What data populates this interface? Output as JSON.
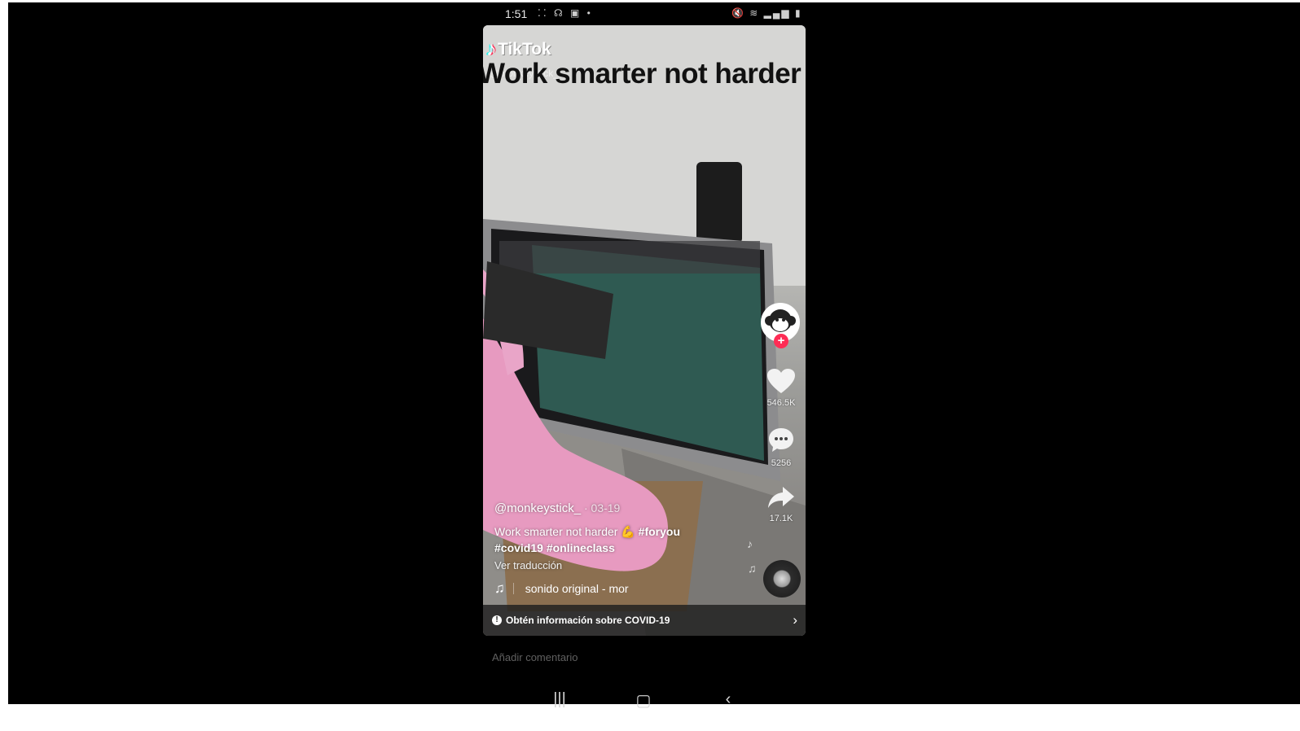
{
  "status_bar": {
    "time": "1:51",
    "left_icons": "⁚⁚ ☊ ▣ •",
    "right_icons": "🔇 ≋ ▂▄▆ ▮"
  },
  "video": {
    "brand": "TikTok",
    "brand_icon": "tiktok-note-icon",
    "watermark_handle": "@monkeystick_",
    "overlay_text": "Work smarter not harder"
  },
  "actions": {
    "likes": "546.5K",
    "comments": "5256",
    "shares": "17.1K"
  },
  "caption": {
    "author": "@monkeystick_",
    "date": " · 03-19",
    "text": "Work smarter not harder 💪",
    "tag_1": "#foryou",
    "tag_2": "#covid19",
    "tag_3": "#onlineclass",
    "translate": "Ver traducción"
  },
  "sound": {
    "icon": "♫",
    "label": "sonido original - mor"
  },
  "covid_banner": {
    "label": "Obtén información sobre COVID-19",
    "chevron": "›"
  },
  "comment": {
    "placeholder": "Añadir comentario"
  },
  "nav": {
    "recents": "|||",
    "home": "▢",
    "back": "‹"
  },
  "colors": {
    "accent": "#fe2c55",
    "background": "#000000"
  }
}
